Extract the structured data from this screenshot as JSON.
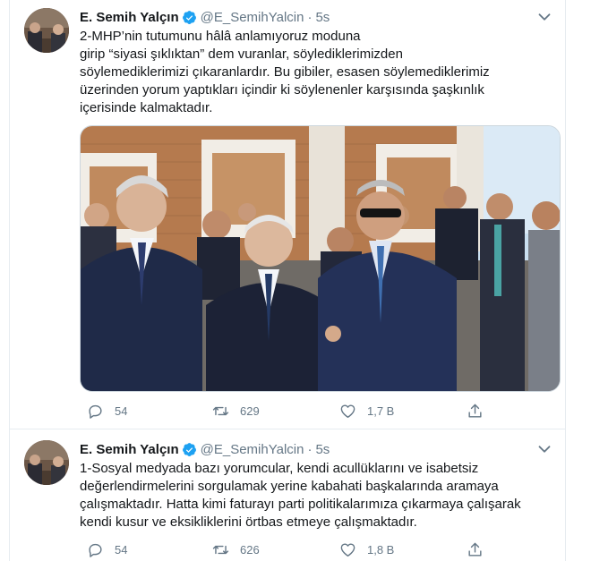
{
  "tweets": [
    {
      "author": {
        "name": "E. Semih Yalçın",
        "handle": "@E_SemihYalcin",
        "time": "5s"
      },
      "text": "2-MHP’nin tutumunu hâlâ anlamıyoruz moduna\ngirip “siyasi şıklıktan” dem vuranlar, söylediklerimizden\nsöylemediklerimizi çıkaranlardır. Bu gibiler, esasen söylemediklerimiz\nüzerinden yorum yaptıkları içindir ki söylenenler karşısında şaşkınlık\niçerisinde kalmaktadır.",
      "stats": {
        "replies": "54",
        "retweets": "629",
        "likes": "1,7 B"
      }
    },
    {
      "author": {
        "name": "E. Semih Yalçın",
        "handle": "@E_SemihYalcin",
        "time": "5s"
      },
      "text": "1-Sosyal medyada bazı yorumcular, kendi acullüklarını ve isabetsiz\ndeğerlendirmelerini sorgulamak yerine kabahati başkalarında aramaya\nçalışmaktadır. Hatta kimi faturayı parti politikalarımıza çıkarmaya çalışarak\nkendi kusur ve eksikliklerini örtbas etmeye çalışmaktadır.",
      "stats": {
        "replies": "54",
        "retweets": "626",
        "likes": "1,8 B"
      }
    }
  ],
  "colors": {
    "verified": "#1da1f2",
    "secondary_text": "#657786",
    "border": "#e6ecf0"
  },
  "icons": [
    "verified-badge-icon",
    "chevron-down-icon",
    "reply-icon",
    "retweet-icon",
    "like-icon",
    "share-icon"
  ]
}
